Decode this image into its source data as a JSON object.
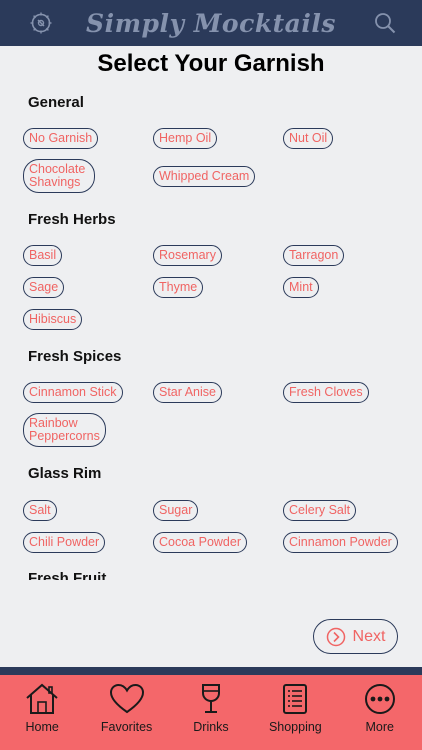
{
  "header": {
    "app_title": "Simply Mocktails"
  },
  "page_title": "Select Your Garnish",
  "sections": [
    {
      "title": "General",
      "chips": [
        "No Garnish",
        "Hemp Oil",
        "Nut Oil",
        "Chocolate Shavings",
        "Whipped Cream"
      ]
    },
    {
      "title": "Fresh Herbs",
      "chips": [
        "Basil",
        "Rosemary",
        "Tarragon",
        "Sage",
        "Thyme",
        "Mint",
        "Hibiscus"
      ]
    },
    {
      "title": "Fresh Spices",
      "chips": [
        "Cinnamon Stick",
        "Star Anise",
        "Fresh Cloves",
        "Rainbow Peppercorns"
      ]
    },
    {
      "title": "Glass Rim",
      "chips": [
        "Salt",
        "Sugar",
        "Celery Salt",
        "Chili Powder",
        "Cocoa Powder",
        "Cinnamon Powder"
      ]
    },
    {
      "title": "Fresh Fruit",
      "chips": []
    }
  ],
  "next_label": "Next",
  "tabs": [
    {
      "label": "Home",
      "icon": "house-icon"
    },
    {
      "label": "Favorites",
      "icon": "heart-icon"
    },
    {
      "label": "Drinks",
      "icon": "wine-glass-icon"
    },
    {
      "label": "Shopping",
      "icon": "shopping-list-icon"
    },
    {
      "label": "More",
      "icon": "ellipsis-icon"
    }
  ],
  "colors": {
    "navy": "#2b3a5a",
    "accent": "#f06463",
    "tabbar": "#f4676a",
    "background": "#eeeff1"
  }
}
